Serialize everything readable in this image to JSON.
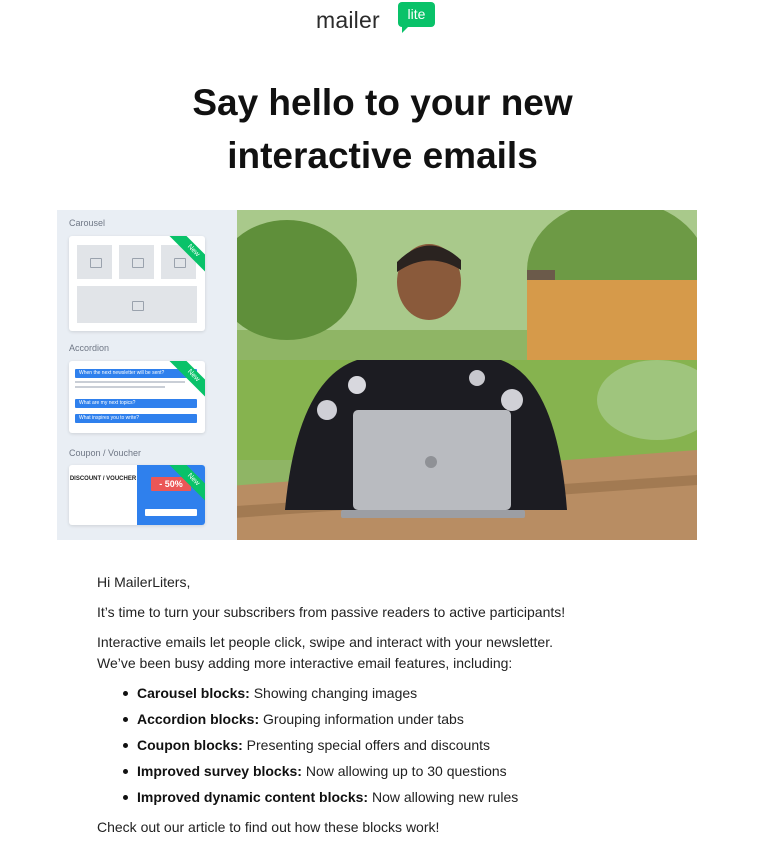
{
  "logo": {
    "word": "mailer",
    "badge": "lite"
  },
  "headline": {
    "line1": "Say hello to your new",
    "line2": "interactive emails"
  },
  "hero": {
    "blocks": [
      {
        "title": "Carousel",
        "ribbon": "New"
      },
      {
        "title": "Accordion",
        "ribbon": "New"
      },
      {
        "title": "Coupon / Voucher",
        "ribbon": "New"
      }
    ],
    "accordion_items": [
      "When the next newsletter will be sent?",
      "What are my next topics?",
      "What inspires you to write?"
    ],
    "coupon": {
      "title": "DISCOUNT / VOUCHER",
      "value": "- 50%"
    },
    "colors": {
      "green": "#09c269",
      "blue": "#2f80ed",
      "red": "#eb5757"
    }
  },
  "body": {
    "greeting": "Hi MailerLiters,",
    "p1": "It’s time to turn your subscribers from passive readers to active participants!",
    "p2a": "Interactive emails let people click, swipe and interact with your newsletter.",
    "p2b": "We’ve been busy adding more interactive email features, including:",
    "features": [
      {
        "name": "Carousel blocks:",
        "desc": " Showing changing images"
      },
      {
        "name": "Accordion blocks:",
        "desc": " Grouping information under tabs"
      },
      {
        "name": "Coupon blocks:",
        "desc": " Presenting special offers and discounts"
      },
      {
        "name": "Improved survey blocks:",
        "desc": " Now allowing up to 30 questions"
      },
      {
        "name": "Improved dynamic content blocks:",
        "desc": " Now allowing new rules"
      }
    ],
    "closing": "Check out our article to find out how these blocks work!"
  }
}
